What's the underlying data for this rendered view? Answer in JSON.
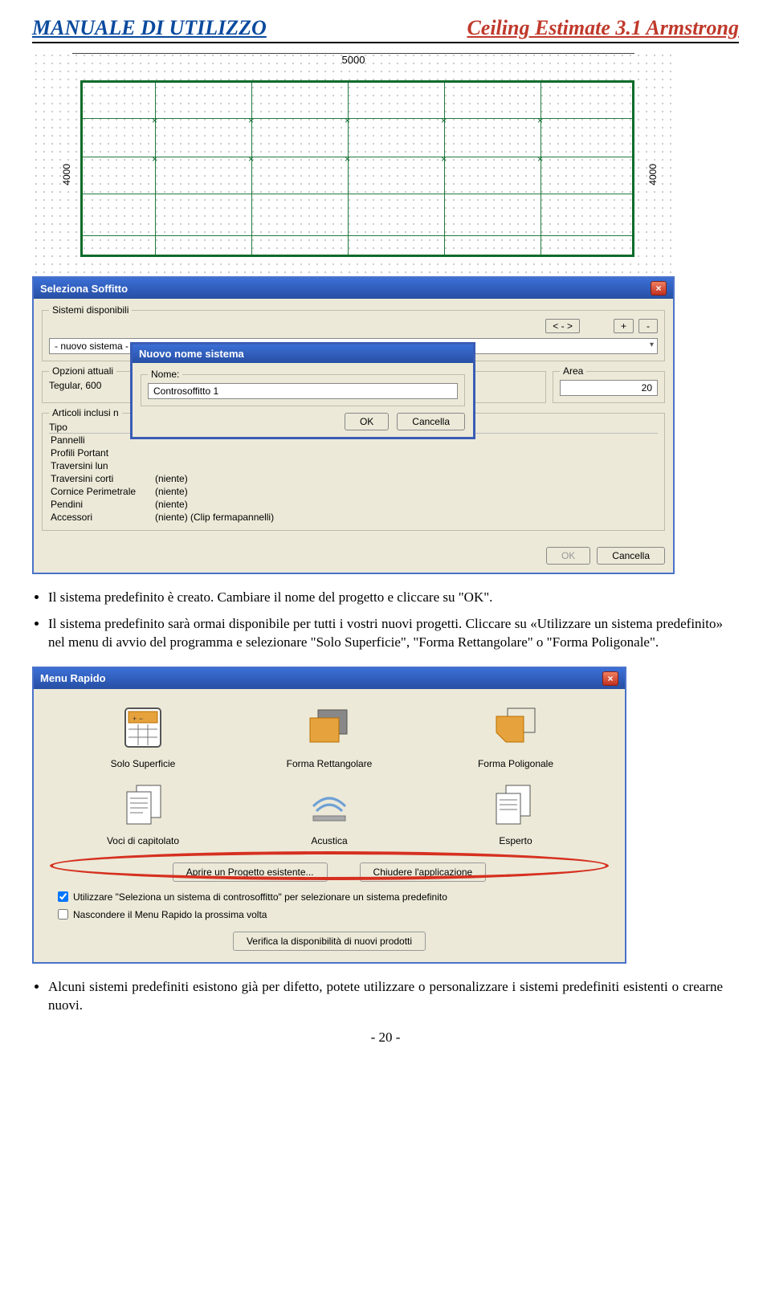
{
  "header": {
    "left": "MANUALE DI UTILIZZO",
    "right": "Ceiling Estimate 3.1 Armstrong"
  },
  "drawing": {
    "width_label": "5000",
    "height_label_left": "4000",
    "height_label_right": "4000"
  },
  "window1": {
    "title": "Seleziona Soffitto",
    "sistemi_label": "Sistemi disponibili",
    "nav_btn": "< - >",
    "plus_btn": "+",
    "minus_btn": "-",
    "combo_value": "- nuovo sistema -",
    "opzioni_label": "Opzioni attuali",
    "opzioni_value": "Tegular, 600",
    "area_label": "Area",
    "area_value": "20",
    "articoli_label": "Articoli inclusi n",
    "col_tipo": "Tipo",
    "rows": [
      {
        "type": "Pannelli",
        "val": ""
      },
      {
        "type": "Profili Portant",
        "val": ""
      },
      {
        "type": "Traversini lun",
        "val": ""
      },
      {
        "type": "Traversini corti",
        "val": "(niente)"
      },
      {
        "type": "Cornice Perimetrale",
        "val": "(niente)"
      },
      {
        "type": "Pendini",
        "val": "(niente)"
      },
      {
        "type": "Accessori",
        "val": "(niente) (Clip fermapannelli)"
      }
    ],
    "ok": "OK",
    "cancel": "Cancella"
  },
  "dialog": {
    "title": "Nuovo nome sistema",
    "nome_label": "Nome:",
    "nome_value": "Controsoffitto 1",
    "ok": "OK",
    "cancel": "Cancella"
  },
  "body_text": {
    "b1": "Il sistema predefinito è creato. Cambiare il nome del progetto e cliccare su \"OK\".",
    "b2": "Il sistema predefinito sarà ormai disponibile per tutti i vostri nuovi progetti. Cliccare su «Utilizzare un sistema predefinito» nel menu di avvio del programma e selezionare \"Solo Superficie\", \"Forma Rettangolare\" o \"Forma Poligonale\"."
  },
  "menu_rapido": {
    "title": "Menu Rapido",
    "items": [
      "Solo Superficie",
      "Forma Rettangolare",
      "Forma Poligonale",
      "Voci di capitolato",
      "Acustica",
      "Esperto"
    ],
    "open_btn": "Aprire un Progetto esistente...",
    "close_btn": "Chiudere l'applicazione",
    "check1": "Utilizzare \"Seleziona un sistema di controsoffitto\" per selezionare un sistema predefinito",
    "check2": "Nascondere il Menu Rapido la prossima volta",
    "verify_btn": "Verifica la disponibilità di nuovi prodotti"
  },
  "body_text2": {
    "b3": "Alcuni sistemi predefiniti esistono già per difetto, potete utilizzare o personalizzare i sistemi predefiniti esistenti o crearne nuovi."
  },
  "page_number": "- 20 -"
}
